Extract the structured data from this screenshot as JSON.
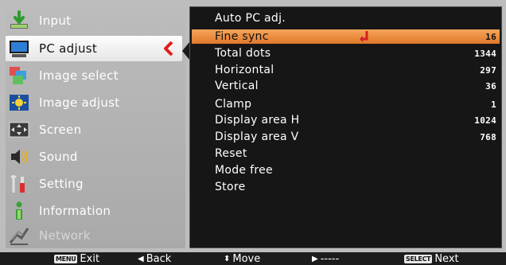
{
  "left_menu": {
    "items": [
      {
        "label": "Input",
        "icon": "input-icon",
        "state": "normal"
      },
      {
        "label": "PC adjust",
        "icon": "pc-adjust-icon",
        "state": "selected"
      },
      {
        "label": "Image select",
        "icon": "image-select-icon",
        "state": "normal"
      },
      {
        "label": "Image adjust",
        "icon": "image-adjust-icon",
        "state": "normal"
      },
      {
        "label": "Screen",
        "icon": "screen-icon",
        "state": "normal"
      },
      {
        "label": "Sound",
        "icon": "sound-icon",
        "state": "normal"
      },
      {
        "label": "Setting",
        "icon": "setting-icon",
        "state": "normal"
      },
      {
        "label": "Information",
        "icon": "information-icon",
        "state": "normal"
      },
      {
        "label": "Network",
        "icon": "network-icon",
        "state": "disabled"
      }
    ]
  },
  "right_panel": {
    "items": [
      {
        "label": "Auto PC adj.",
        "value": ""
      },
      {
        "label": "Fine sync",
        "value": "16",
        "selected": true
      },
      {
        "label": "Total dots",
        "value": "1344"
      },
      {
        "label": "Horizontal",
        "value": "297"
      },
      {
        "label": "Vertical",
        "value": "36"
      },
      {
        "label": "Clamp",
        "value": "1"
      },
      {
        "label": "Display area H",
        "value": "1024"
      },
      {
        "label": "Display area V",
        "value": "768"
      },
      {
        "label": "Reset",
        "value": ""
      },
      {
        "label": "Mode free",
        "value": ""
      },
      {
        "label": "Store",
        "value": ""
      }
    ]
  },
  "bottom_bar": {
    "menu_key": "MENU",
    "exit_label": "Exit",
    "back_label": "Back",
    "move_label": "Move",
    "forward_label": "-----",
    "select_key": "SELECT",
    "next_label": "Next"
  },
  "colors": {
    "selection_orange": "#e8873a",
    "panel_black": "#161616",
    "menu_gray": "#b3b3b3",
    "arrow_red": "#e02020"
  }
}
